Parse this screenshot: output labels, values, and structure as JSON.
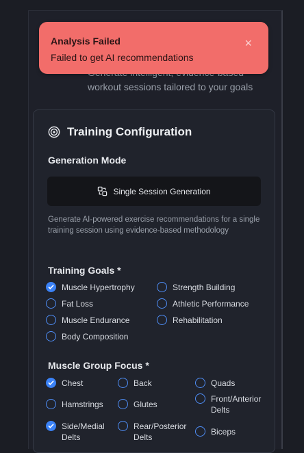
{
  "toast": {
    "title": "Analysis Failed",
    "message": "Failed to get AI recommendations",
    "close": "×"
  },
  "header": {
    "subtitle_line1": "Generate intelligent, evidence-based",
    "subtitle_line2": "workout sessions tailored to your goals"
  },
  "config": {
    "title": "Training Configuration",
    "generation_mode_label": "Generation Mode",
    "mode_button": "Single Session Generation",
    "description": "Generate AI-powered exercise recommendations for a single training session using evidence-based methodology",
    "goals_label": "Training Goals *",
    "goals": [
      {
        "label": "Muscle Hypertrophy",
        "checked": true
      },
      {
        "label": "Strength Building",
        "checked": false
      },
      {
        "label": "Fat Loss",
        "checked": false
      },
      {
        "label": "Athletic Performance",
        "checked": false
      },
      {
        "label": "Muscle Endurance",
        "checked": false
      },
      {
        "label": "Rehabilitation",
        "checked": false
      },
      {
        "label": "Body Composition",
        "checked": false
      }
    ],
    "muscle_label": "Muscle Group Focus *",
    "muscles": [
      {
        "label": "Chest",
        "checked": true
      },
      {
        "label": "Back",
        "checked": false
      },
      {
        "label": "Quads",
        "checked": false
      },
      {
        "label": "Hamstrings",
        "checked": false
      },
      {
        "label": "Glutes",
        "checked": false
      },
      {
        "label": "Front/Anterior Delts",
        "checked": false
      },
      {
        "label": "Side/Medial Delts",
        "checked": true
      },
      {
        "label": "Rear/Posterior Delts",
        "checked": false
      },
      {
        "label": "Biceps",
        "checked": false
      }
    ]
  },
  "colors": {
    "accent": "#3b82f6",
    "toast_bg": "#f26d6a",
    "background": "#1b1d24"
  }
}
